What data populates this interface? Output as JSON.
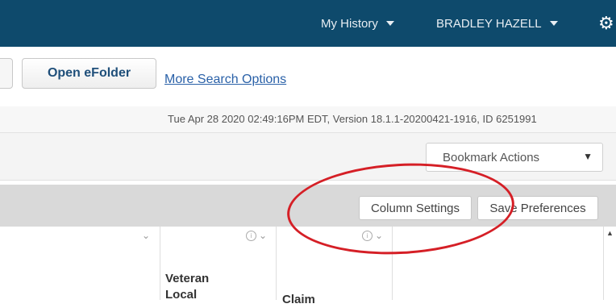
{
  "header": {
    "history_menu": "My History",
    "user_menu": "BRADLEY HAZELL",
    "settings_icon": "gear-icon"
  },
  "search_actions": {
    "open_efolder": "Open eFolder",
    "more_search_options": "More Search Options"
  },
  "status": {
    "text": "Tue Apr 28 2020 02:49:16PM EDT, Version 18.1.1-20200421-1916, ID 6251991"
  },
  "bookmarks": {
    "selected": "Bookmark Actions"
  },
  "toolbar": {
    "column_settings": "Column Settings",
    "save_preferences": "Save Preferences"
  },
  "grid": {
    "columns": [
      {
        "title": ""
      },
      {
        "title": "Veteran\nLocal"
      },
      {
        "title": "Claim"
      },
      {
        "title": ""
      }
    ]
  },
  "colors": {
    "header_bg": "#0e4a6c",
    "link": "#2a61a8",
    "annotation": "#d51f26"
  }
}
